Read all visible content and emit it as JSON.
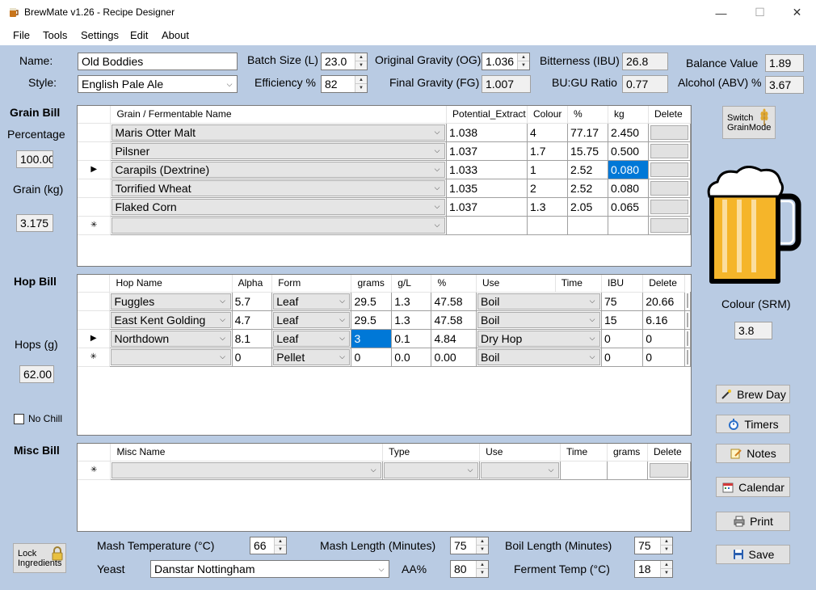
{
  "window": {
    "title": "BrewMate v1.26 - Recipe Designer",
    "minimize": "—",
    "maximize": "☐",
    "close": "✕"
  },
  "menu": [
    {
      "label": "File"
    },
    {
      "label": "Tools"
    },
    {
      "label": "Settings"
    },
    {
      "label": "Edit"
    },
    {
      "label": "About"
    }
  ],
  "recipe": {
    "name_label": "Name:",
    "name": "Old Boddies",
    "style_label": "Style:",
    "style": "English Pale Ale",
    "batch_label": "Batch Size (L)",
    "batch": "23.0",
    "efficiency_label": "Efficiency %",
    "efficiency": "82",
    "og_label": "Original Gravity (OG)",
    "og": "1.036",
    "fg_label": "Final Gravity (FG)",
    "fg": "1.007",
    "ibu_label": "Bitterness (IBU)",
    "ibu": "26.8",
    "bugu_label": "BU:GU Ratio",
    "bugu": "0.77",
    "balance_label": "Balance Value",
    "balance": "1.89",
    "abv_label": "Alcohol (ABV) %",
    "abv": "3.67"
  },
  "grain": {
    "title": "Grain Bill",
    "pct_label": "Percentage",
    "pct": "100.00",
    "kg_label": "Grain (kg)",
    "kg": "3.175",
    "headers": [
      "Grain / Fermentable Name",
      "Potential_Extract",
      "Colour",
      "%",
      "kg",
      "Delete"
    ],
    "rows": [
      {
        "name": "Maris Otter Malt",
        "extract": "1.038",
        "colour": "4",
        "pct": "77.17",
        "kg": "2.450"
      },
      {
        "name": "Pilsner",
        "extract": "1.037",
        "colour": "1.7",
        "pct": "15.75",
        "kg": "0.500"
      },
      {
        "name": "Carapils (Dextrine)",
        "extract": "1.033",
        "colour": "1",
        "pct": "2.52",
        "kg": "0.080"
      },
      {
        "name": "Torrified Wheat",
        "extract": "1.035",
        "colour": "2",
        "pct": "2.52",
        "kg": "0.080"
      },
      {
        "name": "Flaked Corn",
        "extract": "1.037",
        "colour": "1.3",
        "pct": "2.05",
        "kg": "0.065"
      }
    ],
    "switch_label_1": "Switch",
    "switch_label_2": "GrainMode"
  },
  "hop": {
    "title": "Hop Bill",
    "hops_label": "Hops (g)",
    "hops": "62.00",
    "nochill_label": "No Chill",
    "headers": [
      "Hop Name",
      "Alpha",
      "Form",
      "grams",
      "g/L",
      "%",
      "Use",
      "Time",
      "IBU",
      "Delete"
    ],
    "rows": [
      {
        "name": "Fuggles",
        "alpha": "5.7",
        "form": "Leaf",
        "grams": "29.5",
        "gl": "1.3",
        "pct": "47.58",
        "use": "Boil",
        "time": "75",
        "ibu": "20.66"
      },
      {
        "name": "East Kent Golding",
        "alpha": "4.7",
        "form": "Leaf",
        "grams": "29.5",
        "gl": "1.3",
        "pct": "47.58",
        "use": "Boil",
        "time": "15",
        "ibu": "6.16"
      },
      {
        "name": "Northdown",
        "alpha": "8.1",
        "form": "Leaf",
        "grams": "3",
        "gl": "0.1",
        "pct": "4.84",
        "use": "Dry Hop",
        "time": "0",
        "ibu": "0"
      }
    ],
    "new_row": {
      "alpha": "0",
      "form": "Pellet",
      "grams": "0",
      "gl": "0.0",
      "pct": "0.00",
      "use": "Boil",
      "time": "0",
      "ibu": "0"
    }
  },
  "misc": {
    "title": "Misc Bill",
    "headers": [
      "Misc Name",
      "Type",
      "Use",
      "Time",
      "grams",
      "Delete"
    ]
  },
  "colour": {
    "label": "Colour (SRM)",
    "value": "3.8",
    "beer_color": "#f5b52a"
  },
  "buttons": {
    "brewday": "Brew Day",
    "timers": "Timers",
    "notes": "Notes",
    "calendar": "Calendar",
    "print": "Print",
    "save": "Save",
    "lock_1": "Lock",
    "lock_2": "Ingredients"
  },
  "bottom": {
    "mash_temp_label": "Mash Temperature (°C)",
    "mash_temp": "66",
    "mash_len_label": "Mash Length (Minutes)",
    "mash_len": "75",
    "boil_len_label": "Boil Length (Minutes)",
    "boil_len": "75",
    "yeast_label": "Yeast",
    "yeast": "Danstar Nottingham",
    "aa_label": "AA%",
    "aa": "80",
    "ferment_label": "Ferment Temp (°C)",
    "ferment": "18"
  },
  "icons": {
    "row_pointer": "▶",
    "new_row": "✳",
    "dropdown": "⌵"
  }
}
